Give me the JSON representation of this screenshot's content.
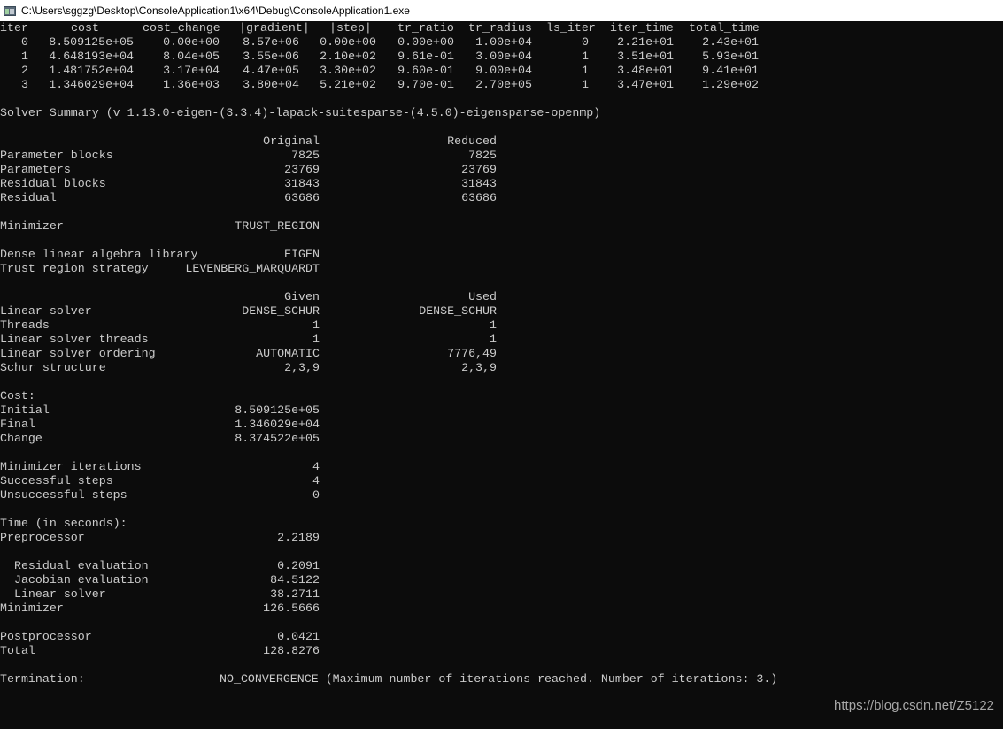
{
  "window": {
    "title": "C:\\Users\\sggzg\\Desktop\\ConsoleApplication1\\x64\\Debug\\ConsoleApplication1.exe",
    "icon": "console-app-icon"
  },
  "iterations": {
    "headers": [
      "iter",
      "cost",
      "cost_change",
      "|gradient|",
      "|step|",
      "tr_ratio",
      "tr_radius",
      "ls_iter",
      "iter_time",
      "total_time"
    ],
    "rows": [
      [
        "0",
        "8.509125e+05",
        "0.00e+00",
        "8.57e+06",
        "0.00e+00",
        "0.00e+00",
        "1.00e+04",
        "0",
        "2.21e+01",
        "2.43e+01"
      ],
      [
        "1",
        "4.648193e+04",
        "8.04e+05",
        "3.55e+06",
        "2.10e+02",
        "9.61e-01",
        "3.00e+04",
        "1",
        "3.51e+01",
        "5.93e+01"
      ],
      [
        "2",
        "1.481752e+04",
        "3.17e+04",
        "4.47e+05",
        "3.30e+02",
        "9.60e-01",
        "9.00e+04",
        "1",
        "3.48e+01",
        "9.41e+01"
      ],
      [
        "3",
        "1.346029e+04",
        "1.36e+03",
        "3.80e+04",
        "5.21e+02",
        "9.70e-01",
        "2.70e+05",
        "1",
        "3.47e+01",
        "1.29e+02"
      ]
    ]
  },
  "summary": {
    "title": "Solver Summary (v 1.13.0-eigen-(3.3.4)-lapack-suitesparse-(4.5.0)-eigensparse-openmp)",
    "size_headers": [
      "Original",
      "Reduced"
    ],
    "size_rows": [
      {
        "label": "Parameter blocks",
        "original": "7825",
        "reduced": "7825"
      },
      {
        "label": "Parameters",
        "original": "23769",
        "reduced": "23769"
      },
      {
        "label": "Residual blocks",
        "original": "31843",
        "reduced": "31843"
      },
      {
        "label": "Residual",
        "original": "63686",
        "reduced": "63686"
      }
    ],
    "minimizer": {
      "label": "Minimizer",
      "value": "TRUST_REGION"
    },
    "dense_lib": {
      "label": "Dense linear algebra library",
      "value": "EIGEN"
    },
    "trust_strategy": {
      "label": "Trust region strategy",
      "value": "LEVENBERG_MARQUARDT"
    },
    "solver_headers": [
      "Given",
      "Used"
    ],
    "solver_rows": [
      {
        "label": "Linear solver",
        "given": "DENSE_SCHUR",
        "used": "DENSE_SCHUR"
      },
      {
        "label": "Threads",
        "given": "1",
        "used": "1"
      },
      {
        "label": "Linear solver threads",
        "given": "1",
        "used": "1"
      },
      {
        "label": "Linear solver ordering",
        "given": "AUTOMATIC",
        "used": "7776,49"
      },
      {
        "label": "Schur structure",
        "given": "2,3,9",
        "used": "2,3,9"
      }
    ],
    "cost": {
      "heading": "Cost:",
      "rows": [
        {
          "label": "Initial",
          "value": "8.509125e+05"
        },
        {
          "label": "Final",
          "value": "1.346029e+04"
        },
        {
          "label": "Change",
          "value": "8.374522e+05"
        }
      ]
    },
    "iterations": [
      {
        "label": "Minimizer iterations",
        "value": "4"
      },
      {
        "label": "Successful steps",
        "value": "4"
      },
      {
        "label": "Unsuccessful steps",
        "value": "0"
      }
    ],
    "time": {
      "heading": "Time (in seconds):",
      "preprocessor": {
        "label": "Preprocessor",
        "value": "2.2189"
      },
      "sub_rows": [
        {
          "label": "  Residual evaluation",
          "value": "0.2091"
        },
        {
          "label": "  Jacobian evaluation",
          "value": "84.5122"
        },
        {
          "label": "  Linear solver",
          "value": "38.2711"
        }
      ],
      "minimizer": {
        "label": "Minimizer",
        "value": "126.5666"
      },
      "postprocessor": {
        "label": "Postprocessor",
        "value": "0.0421"
      },
      "total": {
        "label": "Total",
        "value": "128.8276"
      }
    },
    "termination": {
      "label": "Termination:",
      "value": "NO_CONVERGENCE (Maximum number of iterations reached. Number of iterations: 3.)"
    }
  },
  "watermark": "https://blog.csdn.net/Z5122"
}
